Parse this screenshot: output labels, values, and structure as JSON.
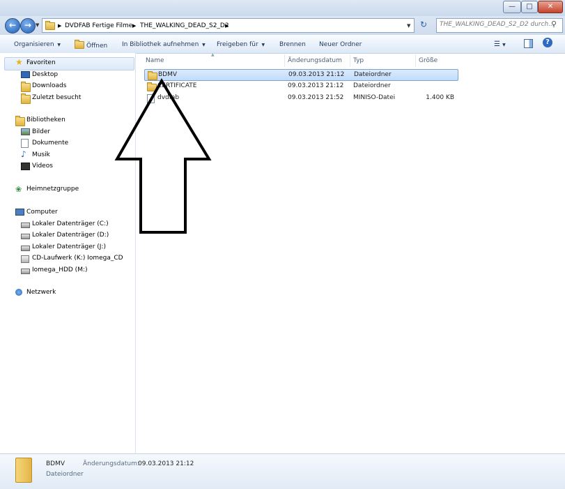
{
  "address": {
    "crumbs": [
      "DVDFAB Fertige Filme",
      "THE_WALKING_DEAD_S2_D2"
    ],
    "search_placeholder": "THE_WALKING_DEAD_S2_D2 durch..."
  },
  "toolbar": {
    "organize": "Organisieren",
    "open": "Öffnen",
    "library": "In Bibliothek aufnehmen",
    "share": "Freigeben für",
    "burn": "Brennen",
    "new_folder": "Neuer Ordner"
  },
  "nav": {
    "favorites": "Favoriten",
    "desktop": "Desktop",
    "downloads": "Downloads",
    "recent": "Zuletzt besucht",
    "libraries": "Bibliotheken",
    "pictures": "Bilder",
    "documents": "Dokumente",
    "music": "Musik",
    "videos": "Videos",
    "homegroup": "Heimnetzgruppe",
    "computer": "Computer",
    "drive_c": "Lokaler Datenträger (C:)",
    "drive_d": "Lokaler Datenträger (D:)",
    "drive_j": "Lokaler Datenträger (J:)",
    "drive_k": "CD-Laufwerk (K:) Iomega_CD",
    "drive_m": "Iomega_HDD (M:)",
    "network": "Netzwerk"
  },
  "columns": {
    "name": "Name",
    "date": "Änderungsdatum",
    "type": "Typ",
    "size": "Größe"
  },
  "files": [
    {
      "name": "BDMV",
      "date": "09.03.2013 21:12",
      "type": "Dateiordner",
      "size": ""
    },
    {
      "name": "CERTIFICATE",
      "date": "09.03.2013 21:12",
      "type": "Dateiordner",
      "size": ""
    },
    {
      "name": "dvdfab",
      "date": "09.03.2013 21:52",
      "type": "MINISO-Datei",
      "size": "1.400 KB"
    }
  ],
  "details": {
    "name": "BDMV",
    "date_label": "Änderungsdatum:",
    "date_value": "09.03.2013 21:12",
    "type": "Dateiordner"
  }
}
